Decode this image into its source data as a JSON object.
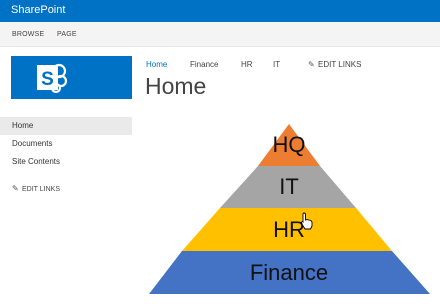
{
  "suite_bar": {
    "title": "SharePoint"
  },
  "ribbon": {
    "tabs": [
      "BROWSE",
      "PAGE"
    ]
  },
  "top_nav": {
    "items": [
      "Home",
      "Finance",
      "HR",
      "IT"
    ],
    "edit_links": "EDIT LINKS"
  },
  "page": {
    "title": "Home"
  },
  "quick_launch": {
    "items": [
      "Home",
      "Documents",
      "Site Contents"
    ],
    "edit_links": "EDIT LINKS"
  },
  "pyramid": {
    "levels": [
      {
        "label": "HQ",
        "color": "#ed7d31"
      },
      {
        "label": "IT",
        "color": "#a5a5a5"
      },
      {
        "label": "HR",
        "color": "#ffc000"
      },
      {
        "label": "Finance",
        "color": "#4472c4"
      }
    ]
  },
  "colors": {
    "brand": "#0072c6"
  },
  "icons": {
    "logo": "sharepoint-logo-icon",
    "edit": "pencil-icon",
    "cursor": "hand-pointer-cursor-icon"
  }
}
